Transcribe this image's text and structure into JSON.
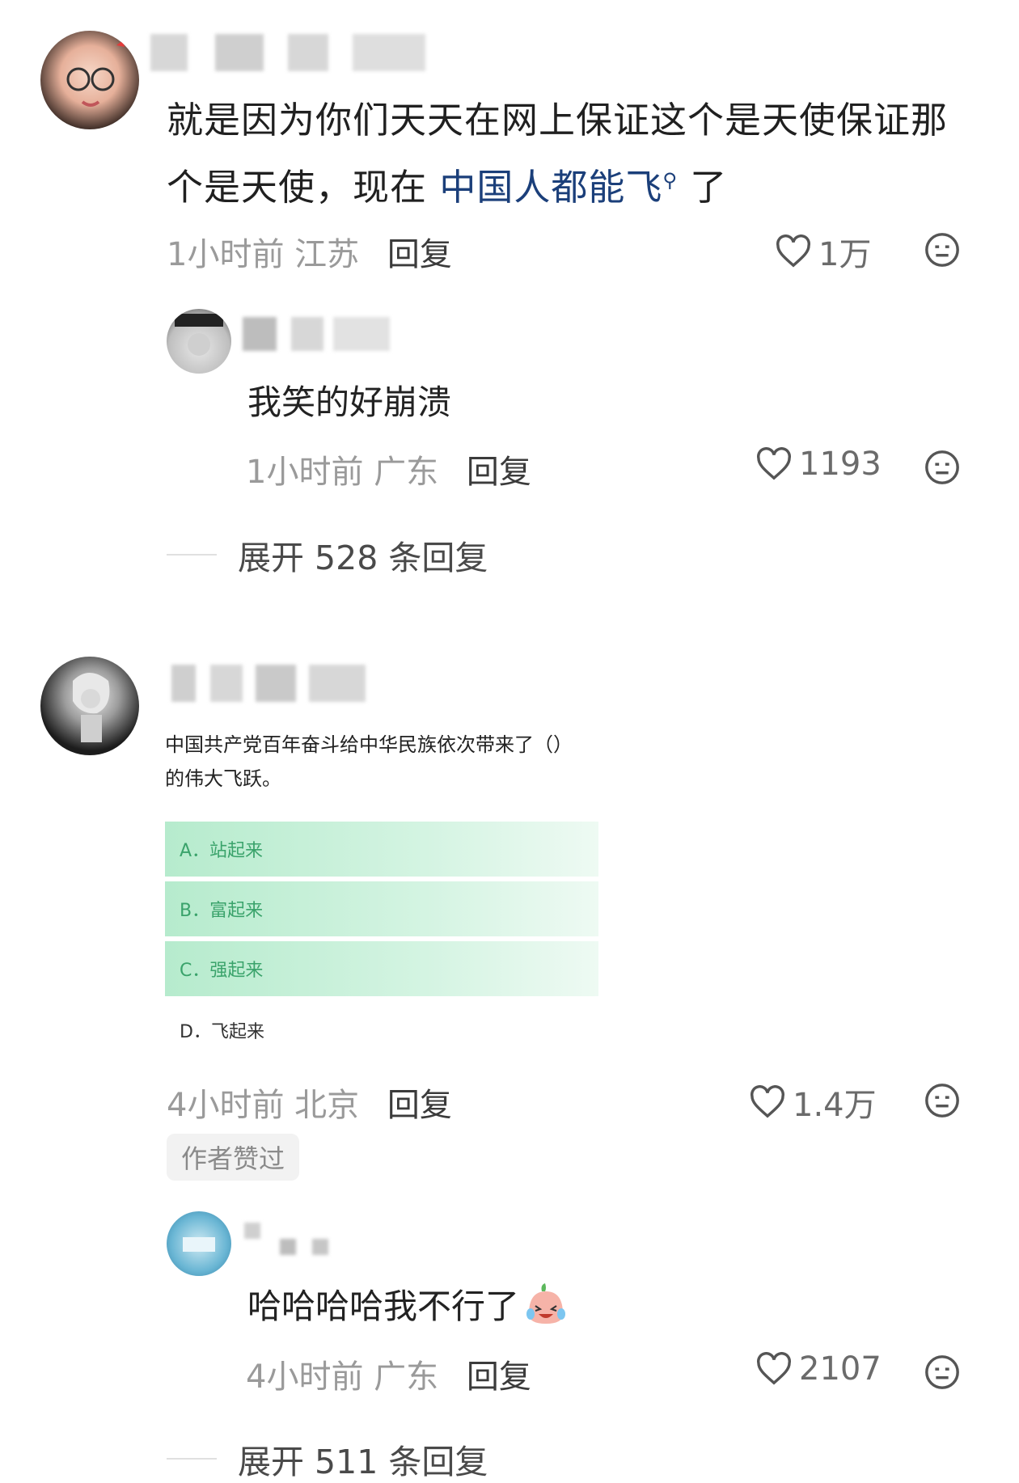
{
  "comments": [
    {
      "text_a": "就是因为你们天天在网上保证这个是天使保证那",
      "text_b": "个是天使，现在",
      "link": "中国人都能飞",
      "link_suffix": "了",
      "time_location": "1小时前 江苏",
      "reply_label": "回复",
      "likes": "1万",
      "replies": [
        {
          "text": "我笑的好崩溃",
          "time_location": "1小时前 广东",
          "reply_label": "回复",
          "likes": "1193"
        }
      ],
      "expand_label": "展开 528 条回复"
    },
    {
      "quiz": {
        "question_1": "中国共产党百年奋斗给中华民族依次带来了（）",
        "question_2": "的伟大飞跃。",
        "options": [
          "A．站起来",
          "B．富起来",
          "C．强起来",
          "D．飞起来"
        ]
      },
      "time_location": "4小时前 北京",
      "reply_label": "回复",
      "likes": "1.4万",
      "author_badge": "作者赞过",
      "replies": [
        {
          "text": "哈哈哈哈我不行了",
          "time_location": "4小时前 广东",
          "reply_label": "回复",
          "likes": "2107"
        }
      ],
      "expand_label": "展开 511 条回复"
    }
  ],
  "icons": {
    "like": "heart-outline-icon",
    "dislike": "meh-face-icon",
    "emoji": "crying-laugh-emoji-icon"
  },
  "colors": {
    "link": "#1b3f7a",
    "quiz_option_green": "#3aa36b"
  }
}
